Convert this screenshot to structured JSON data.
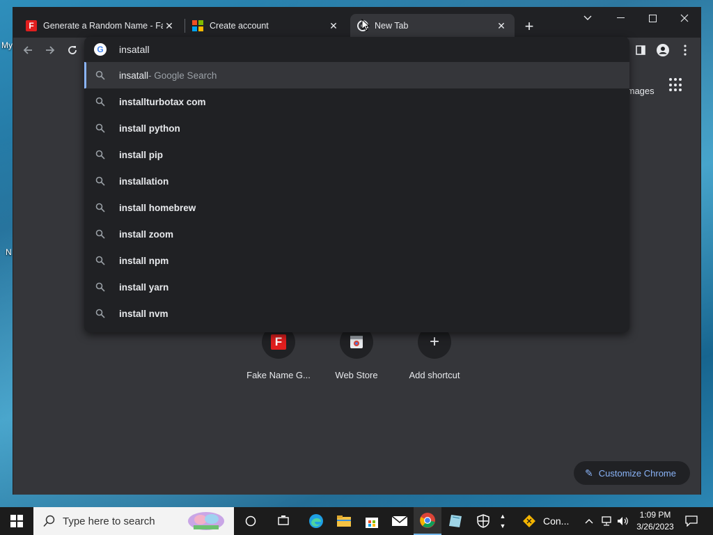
{
  "desktop": {
    "fragments": [
      "My",
      "N"
    ]
  },
  "tabs": [
    {
      "title": "Generate a Random Name - Fake",
      "favicon": "fakename-f-icon"
    },
    {
      "title": "Create account",
      "favicon": "microsoft-icon"
    },
    {
      "title": "New Tab",
      "favicon": "chrome-newtab-icon"
    }
  ],
  "omnibox": {
    "query": "insatall",
    "suggestions": [
      {
        "text": "insatall",
        "suffix": " - Google Search"
      },
      {
        "text": "installturbotax com"
      },
      {
        "text": "install python"
      },
      {
        "text": "install pip"
      },
      {
        "text": "installation"
      },
      {
        "text": "install homebrew"
      },
      {
        "text": "install zoom"
      },
      {
        "text": "install npm"
      },
      {
        "text": "install yarn"
      },
      {
        "text": "install nvm"
      }
    ]
  },
  "newtab": {
    "images_link": "Images",
    "shortcuts": [
      {
        "label": "Fake Name G...",
        "icon": "fakename-f-icon"
      },
      {
        "label": "Web Store",
        "icon": "webstore-icon"
      },
      {
        "label": "Add shortcut",
        "icon": "plus-icon"
      }
    ],
    "customize_label": "Customize Chrome"
  },
  "taskbar": {
    "search_placeholder": "Type here to search",
    "pinned_app_label": "Con...",
    "time": "1:09 PM",
    "date": "3/26/2023"
  },
  "colors": {
    "accent": "#8ab4f8",
    "chrome_dark": "#202124",
    "chrome_mid": "#35363a"
  }
}
